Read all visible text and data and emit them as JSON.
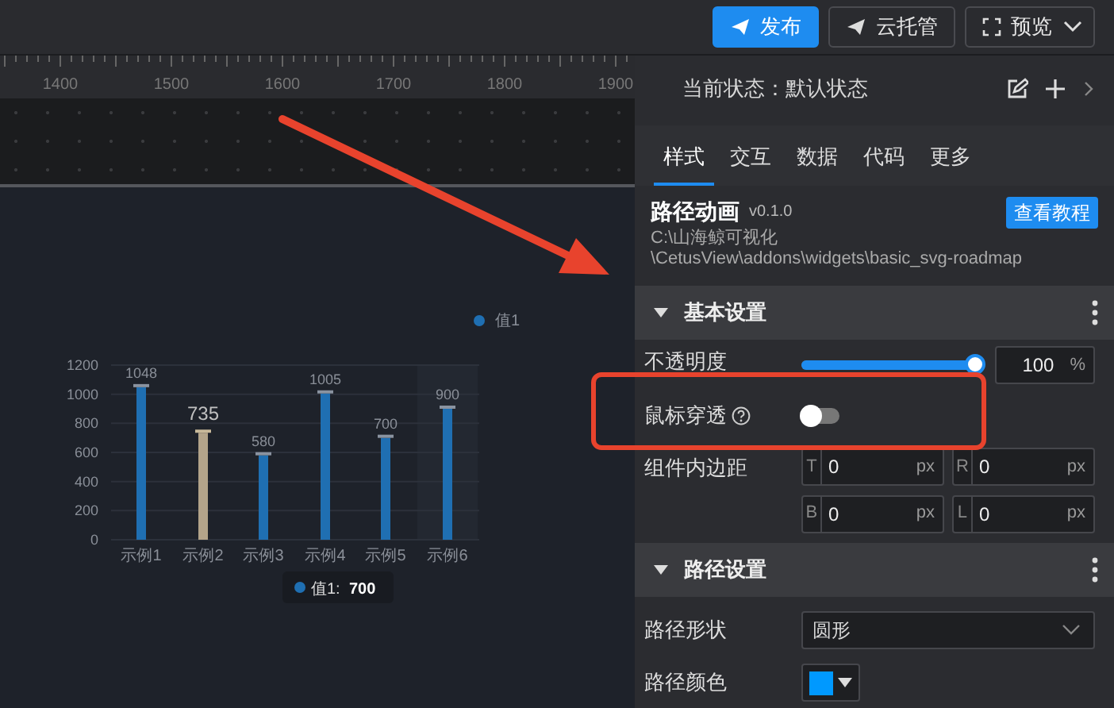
{
  "toolbar": {
    "buttons": [
      {
        "label": "发布",
        "kind": "primary"
      },
      {
        "label": "云托管",
        "kind": "outline"
      },
      {
        "label": "预览",
        "kind": "dropdown"
      }
    ]
  },
  "ruler": {
    "labels": [
      "1400",
      "1500",
      "1600",
      "1700",
      "1800",
      "1900"
    ]
  },
  "chart": {
    "hovered": [
      false,
      false,
      false,
      false,
      false,
      true
    ],
    "tooltip": {
      "label": "值1:",
      "value": "700"
    },
    "chart_data": {
      "type": "bar",
      "categories": [
        "示例1",
        "示例2",
        "示例3",
        "示例4",
        "示例5",
        "示例6"
      ],
      "series": [
        {
          "name": "值1",
          "color": "#1f6fb2",
          "values": [
            1048,
            null,
            580,
            1005,
            700,
            900
          ]
        },
        {
          "color": "#b3a48a",
          "values": [
            null,
            735,
            null,
            null,
            null,
            null
          ]
        }
      ],
      "ylim": [
        0,
        1200
      ],
      "yticks": [
        0,
        200,
        400,
        600,
        800,
        1000,
        1200
      ],
      "grid": true,
      "stacked": true,
      "data_labels": true
    }
  },
  "panel": {
    "state_label": "当前状态：",
    "state_value": "默认状态",
    "tabs": [
      {
        "label": "样式",
        "selected": true
      },
      {
        "label": "交互",
        "selected": false
      },
      {
        "label": "数据",
        "selected": false
      },
      {
        "label": "代码",
        "selected": false
      },
      {
        "label": "更多",
        "selected": false
      }
    ],
    "widget": {
      "title": "路径动画",
      "version": "v0.1.0",
      "tutorial_button": "查看教程",
      "path": [
        "C:\\山海鲸可视化",
        "\\CetusView\\addons\\widgets\\basic_svg-roadmap"
      ]
    },
    "sections": [
      {
        "title": "基本设置",
        "expanded": true,
        "rows": [
          {
            "kind": "slider",
            "label": "不透明度",
            "level": 1,
            "value": "100",
            "unit": "%"
          },
          {
            "kind": "toggle",
            "label": "鼠标穿透",
            "help": true,
            "on": false
          },
          {
            "kind": "padding",
            "label": "组件内边距",
            "fields": [
              {
                "side": "T",
                "value": "0",
                "unit": "px"
              },
              {
                "side": "R",
                "value": "0",
                "unit": "px"
              },
              {
                "side": "B",
                "value": "0",
                "unit": "px"
              },
              {
                "side": "L",
                "value": "0",
                "unit": "px"
              }
            ]
          }
        ]
      },
      {
        "title": "路径设置",
        "expanded": true,
        "rows": [
          {
            "kind": "select",
            "label": "路径形状",
            "value": "圆形"
          },
          {
            "kind": "color",
            "label": "路径颜色",
            "color": "#0099ff"
          }
        ]
      }
    ]
  },
  "annotations": {
    "arrow": true,
    "highlight_frame": true
  }
}
